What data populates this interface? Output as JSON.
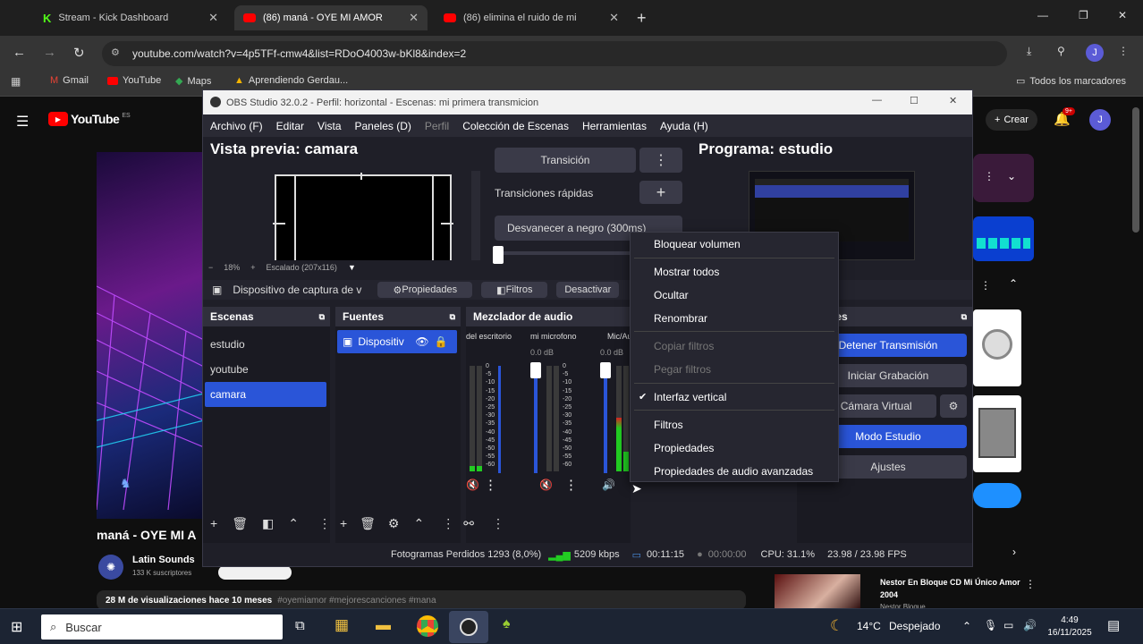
{
  "browser": {
    "tabs": [
      {
        "label": "Stream - Kick Dashboard",
        "favicon": "kick-icon"
      },
      {
        "label": "(86) maná - OYE MI AMOR",
        "favicon": "youtube-icon"
      },
      {
        "label": "(86) elimina el ruido de mi",
        "favicon": "youtube-icon"
      }
    ],
    "url": "youtube.com/watch?v=4p5TFf-cmw4&list=RDoO4003w-bKl8&index=2",
    "bookmarks": [
      "Gmail",
      "YouTube",
      "Maps",
      "Aprendiendo Gerdau..."
    ],
    "all_bookmarks": "Todos los marcadores",
    "profile_initial": "J"
  },
  "youtube": {
    "logo": "YouTube",
    "logo_suffix": "ES",
    "create_label": "Crear",
    "notifications": "9+",
    "avatar": "J",
    "video_title": "maná - OYE MI A",
    "channel": "Latin Sounds",
    "subscribers": "133 K suscriptores",
    "views": "28 M de visualizaciones  hace 10 meses",
    "hashtags": "#oyemiamor #mejorescanciones #mana",
    "related_title": "Nestor En Bloque CD Mi Único Amor 2004",
    "related_channel": "Nestor Bloque"
  },
  "obs": {
    "title": "OBS Studio 32.0.2 - Perfil: horizontal - Escenas: mi primera transmicion",
    "menu": [
      "Archivo (F)",
      "Editar",
      "Vista",
      "Paneles (D)",
      "Perfil",
      "Colección de Escenas",
      "Herramientas",
      "Ayuda (H)"
    ],
    "preview_label": "Vista previa: camara",
    "program_label": "Programa: estudio",
    "transition_btn": "Transición",
    "quick_transitions": "Transiciones rápidas",
    "fade_option": "Desvanecer a negro (300ms)",
    "zoom": "18%",
    "scaled": "Escalado (207x116)",
    "source_bar": {
      "source_name": "Dispositivo de captura de v",
      "properties": "Propiedades",
      "filters": "Filtros",
      "deactivate": "Desactivar"
    },
    "docks": {
      "scenes": "Escenas",
      "sources": "Fuentes",
      "mixer": "Mezclador de audio",
      "controls": "les"
    },
    "scenes": [
      "estudio",
      "youtube",
      "camara"
    ],
    "selected_scene": "camara",
    "source_item": "Dispositiv",
    "mixer_channels": [
      {
        "name": "del escritorio",
        "db": ""
      },
      {
        "name": "mi microfono",
        "db": "0.0 dB"
      },
      {
        "name": "Mic/Au",
        "db": "0.0 dB"
      }
    ],
    "meter_ticks": [
      "0",
      "-5",
      "-10",
      "-15",
      "-20",
      "-25",
      "-30",
      "-35",
      "-40",
      "-45",
      "-50",
      "-55",
      "-60"
    ],
    "controls": [
      "Detener Transmisión",
      "Iniciar Grabación",
      "r Cámara Virtual",
      "Modo Estudio",
      "Ajustes"
    ],
    "context_menu": [
      {
        "label": "Bloquear volumen",
        "disabled": false,
        "checked": false
      },
      {
        "label": "Mostrar todos",
        "disabled": false,
        "checked": false
      },
      {
        "label": "Ocultar",
        "disabled": false,
        "checked": false
      },
      {
        "label": "Renombrar",
        "disabled": false,
        "checked": false
      },
      {
        "label": "Copiar filtros",
        "disabled": true,
        "checked": false
      },
      {
        "label": "Pegar filtros",
        "disabled": true,
        "checked": false
      },
      {
        "label": "Interfaz vertical",
        "disabled": false,
        "checked": true
      },
      {
        "label": "Filtros",
        "disabled": false,
        "checked": false
      },
      {
        "label": "Propiedades",
        "disabled": false,
        "checked": false
      },
      {
        "label": "Propiedades de audio avanzadas",
        "disabled": false,
        "checked": false
      }
    ],
    "status": {
      "dropped_frames": "Fotogramas Perdidos 1293 (8,0%)",
      "bitrate": "5209 kbps",
      "stream_time": "00:11:15",
      "rec_time": "00:00:00",
      "cpu": "CPU: 31.1%",
      "fps": "23.98 / 23.98 FPS"
    }
  },
  "taskbar": {
    "search_placeholder": "Buscar",
    "weather_temp": "14°C",
    "weather_desc": "Despejado",
    "time": "4:49",
    "date": "16/11/2025"
  },
  "colors": {
    "obs_accent": "#2a55d8",
    "youtube_red": "#ff0000",
    "chrome_bg": "#1f1f1f"
  }
}
